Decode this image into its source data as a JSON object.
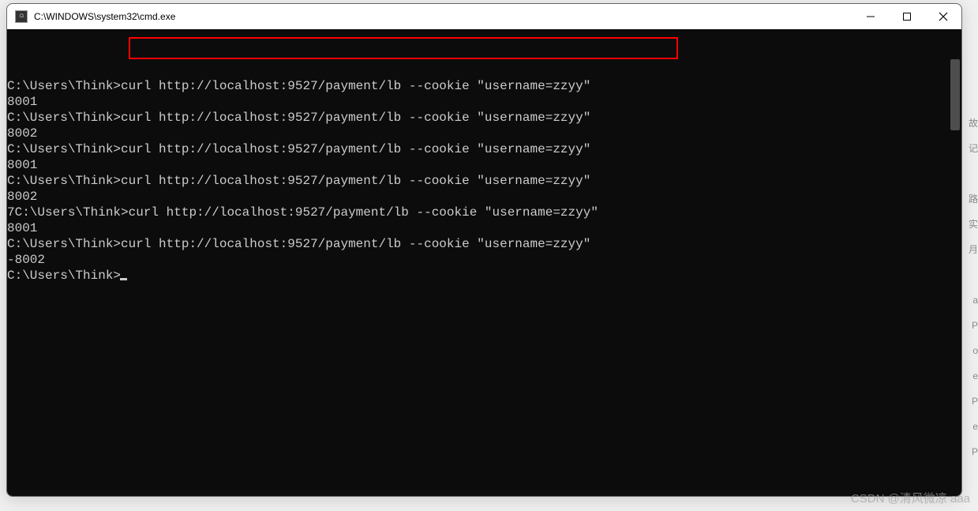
{
  "window": {
    "title": "C:\\WINDOWS\\system32\\cmd.exe"
  },
  "terminal": {
    "prompt": "C:\\Users\\Think>",
    "command": "curl http://localhost:9527/payment/lb --cookie \"username=zzyy\"",
    "lines": [
      {
        "prefix": "",
        "prompt": "C:\\Users\\Think>",
        "cmd": "curl http://localhost:9527/payment/lb --cookie \"username=zzyy\""
      },
      {
        "output": "8001"
      },
      {
        "prefix": "",
        "prompt": "C:\\Users\\Think>",
        "cmd": "curl http://localhost:9527/payment/lb --cookie \"username=zzyy\""
      },
      {
        "output": "8002"
      },
      {
        "prefix": "",
        "prompt": "C:\\Users\\Think>",
        "cmd": "curl http://localhost:9527/payment/lb --cookie \"username=zzyy\""
      },
      {
        "output": "8001"
      },
      {
        "prefix": "",
        "prompt": "C:\\Users\\Think>",
        "cmd": "curl http://localhost:9527/payment/lb --cookie \"username=zzyy\""
      },
      {
        "output": "8002"
      },
      {
        "prefix": "7",
        "prompt": "C:\\Users\\Think>",
        "cmd": "curl http://localhost:9527/payment/lb --cookie \"username=zzyy\""
      },
      {
        "output": "8001"
      },
      {
        "prefix": "",
        "prompt": "C:\\Users\\Think>",
        "cmd": "curl http://localhost:9527/payment/lb --cookie \"username=zzyy\""
      },
      {
        "prefix": "-",
        "output": "8002"
      },
      {
        "prefix": "",
        "prompt": "C:\\Users\\Think>",
        "cmd": "",
        "cursor": true
      }
    ]
  },
  "watermark": "CSDN @清风微凉 aaa",
  "background_hints": [
    "故",
    "记",
    "",
    "路",
    "实",
    "月",
    "",
    "a",
    "P",
    "o",
    "e",
    "P",
    "e",
    "P"
  ]
}
